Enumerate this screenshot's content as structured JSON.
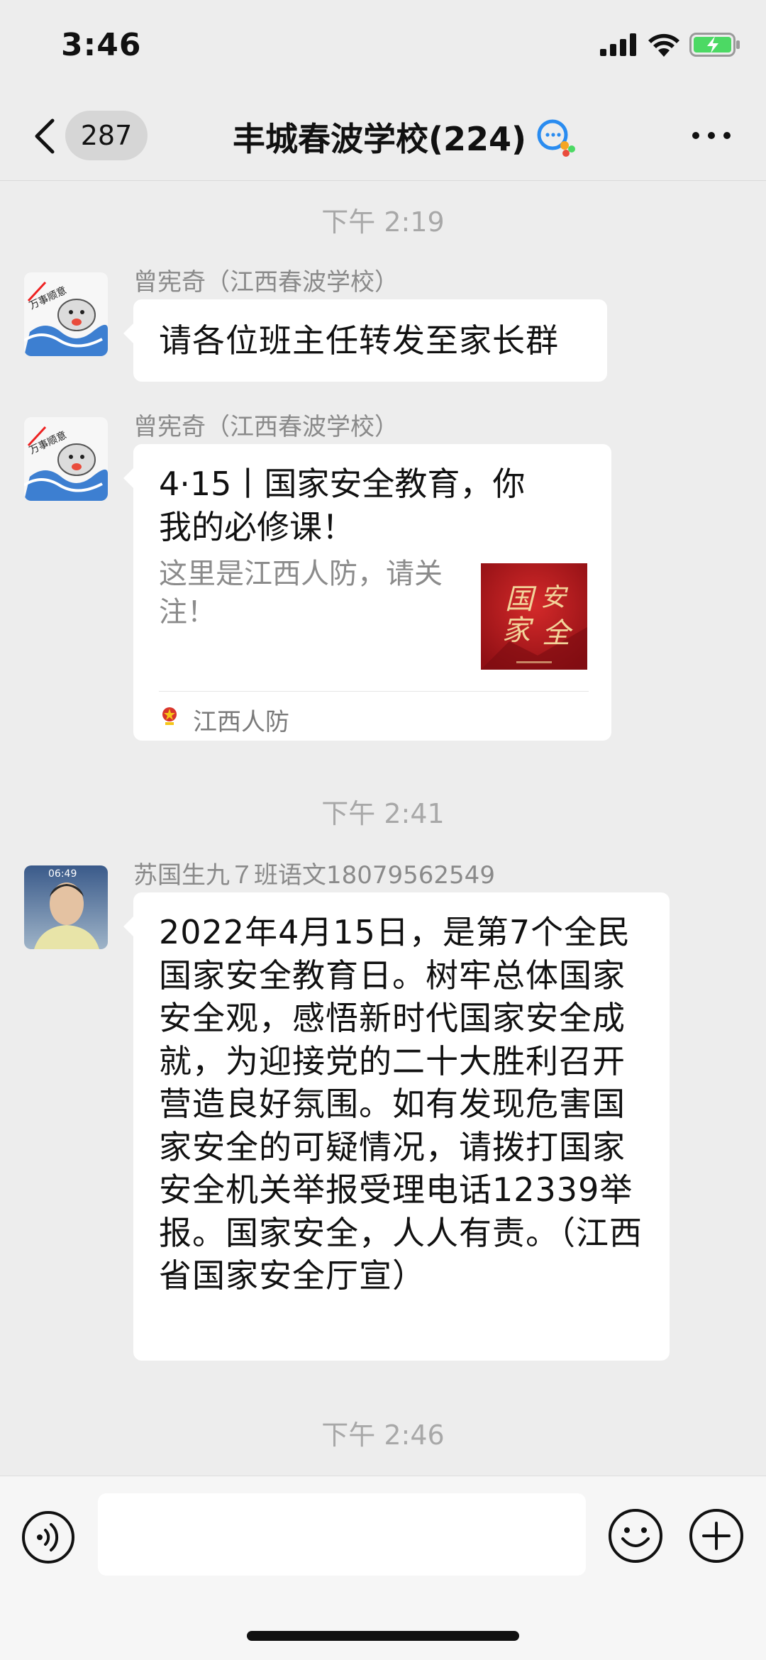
{
  "status_bar": {
    "time": "3:46"
  },
  "nav": {
    "unread_count": "287",
    "title": "丰城春波学校(224)"
  },
  "messages": [
    {
      "timestamp": "下午 2:19"
    },
    {
      "sender": "曾宪奇（江西春波学校）",
      "text": "请各位班主任转发至家长群"
    },
    {
      "sender": "曾宪奇（江西春波学校）",
      "card": {
        "title": "4·15丨国家安全教育，你我的必修课！",
        "description": "这里是江西人防，请关注！",
        "source": "江西人防",
        "thumb_text": "国家安全"
      }
    },
    {
      "timestamp": "下午 2:41"
    },
    {
      "sender": "苏国生九７班语文18079562549",
      "avatar_time": "06:49",
      "text": "2022年4月15日，是第7个全民国家安全教育日。树牢总体国家安全观，感悟新时代国家安全成就，为迎接党的二十大胜利召开营造良好氛围。如有发现危害国家安全的可疑情况，请拨打国家安全机关举报受理电话12339举报。国家安全，人人有责。（江西省国家安全厅宣）"
    },
    {
      "timestamp": "下午 2:46"
    }
  ],
  "colors": {
    "background": "#ededed",
    "bubble": "#ffffff",
    "battery_green": "#4cd964",
    "thumb_red": "#b0161c"
  },
  "icons": {
    "back": "chevron-left-icon",
    "more": "more-dots-icon",
    "voice": "voice-icon",
    "emoji": "emoji-icon",
    "plus": "plus-icon"
  }
}
